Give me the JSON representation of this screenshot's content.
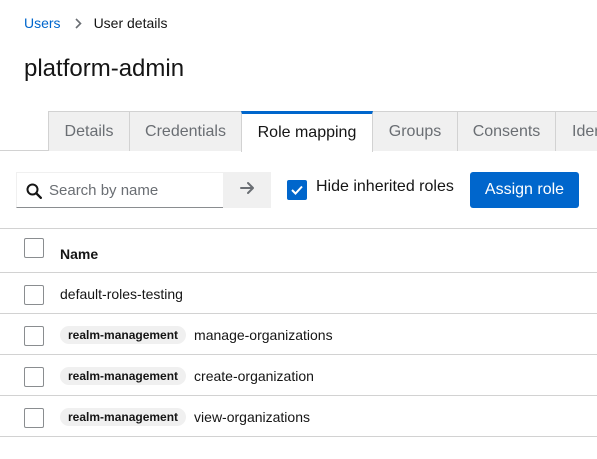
{
  "breadcrumb": {
    "users": "Users",
    "current": "User details"
  },
  "page_title": "platform-admin",
  "tabs": [
    {
      "label": "Details"
    },
    {
      "label": "Credentials"
    },
    {
      "label": "Role mapping"
    },
    {
      "label": "Groups"
    },
    {
      "label": "Consents"
    },
    {
      "label": "Identity provider links"
    }
  ],
  "toolbar": {
    "search_placeholder": "Search by name",
    "search_value": "",
    "hide_inherited_label": "Hide inherited roles",
    "hide_inherited_checked": true,
    "assign_label": "Assign role"
  },
  "table": {
    "name_header": "Name",
    "rows": [
      {
        "client": "",
        "role": "default-roles-testing"
      },
      {
        "client": "realm-management",
        "role": "manage-organizations"
      },
      {
        "client": "realm-management",
        "role": "create-organization"
      },
      {
        "client": "realm-management",
        "role": "view-organizations"
      }
    ]
  },
  "colors": {
    "accent": "#0066cc",
    "border": "#d2d2d2",
    "tab_bg": "#f0f0f0",
    "text": "#151515",
    "muted": "#6a6e73"
  }
}
